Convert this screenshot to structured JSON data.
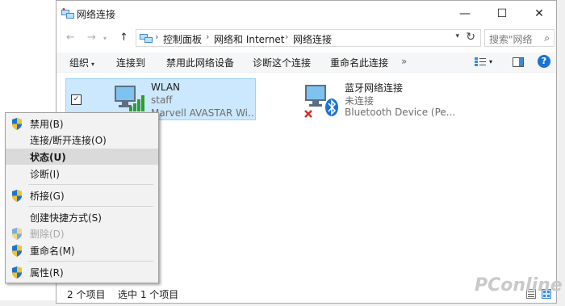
{
  "window": {
    "title": "网络连接"
  },
  "nav": {
    "back": "←",
    "forward": "→",
    "up": "↑"
  },
  "breadcrumbs": [
    "控制面板",
    "网络和 Internet",
    "网络连接"
  ],
  "search": {
    "placeholder": "搜索\"网络"
  },
  "toolbar": {
    "organize": "组织",
    "connect_to": "连接到",
    "disable": "禁用此网络设备",
    "diagnose": "诊断这个连接",
    "rename": "重命名此连接",
    "more": "»"
  },
  "connections": [
    {
      "name": "WLAN",
      "status": "staff",
      "device": "Marvell AVASTAR Wi...",
      "selected": true
    },
    {
      "name": "蓝牙网络连接",
      "status": "未连接",
      "device": "Bluetooth Device (Pe...",
      "selected": false
    }
  ],
  "context_menu": {
    "items": [
      {
        "label": "禁用(B)",
        "icon": "uac-shield-icon"
      },
      {
        "label": "连接/断开连接(O)"
      },
      {
        "label": "状态(U)",
        "highlighted": true
      },
      {
        "label": "诊断(I)"
      },
      {
        "label": "桥接(G)",
        "icon": "uac-shield-icon"
      },
      {
        "label": "创建快捷方式(S)"
      },
      {
        "label": "删除(D)",
        "icon": "uac-shield-icon",
        "disabled": true
      },
      {
        "label": "重命名(M)",
        "icon": "uac-shield-icon"
      },
      {
        "label": "属性(R)",
        "icon": "uac-shield-icon"
      }
    ]
  },
  "status_bar": {
    "count": "2 个项目",
    "selected": "选中 1 个项目"
  },
  "watermark": "PConline",
  "colors": {
    "selection": "#cce8ff",
    "selection_border": "#99d1ff",
    "accent": "#1b73d3",
    "menu_bg": "#f2f2f2"
  }
}
